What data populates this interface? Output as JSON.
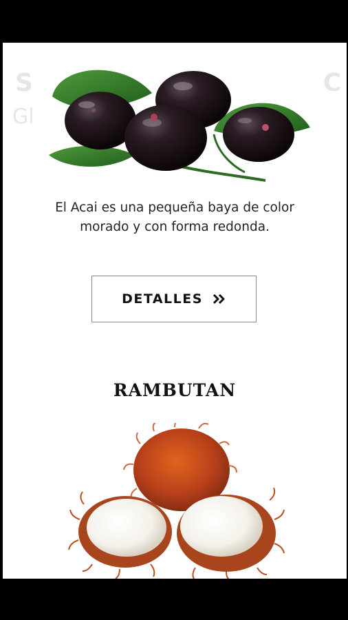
{
  "acai": {
    "description": "El Acai es una pequeña baya de color morado y con forma redonda.",
    "button_label": "DETALLES",
    "button_icon": "double-chevron-right-icon"
  },
  "rambutan": {
    "title": "RAMBUTAN"
  }
}
